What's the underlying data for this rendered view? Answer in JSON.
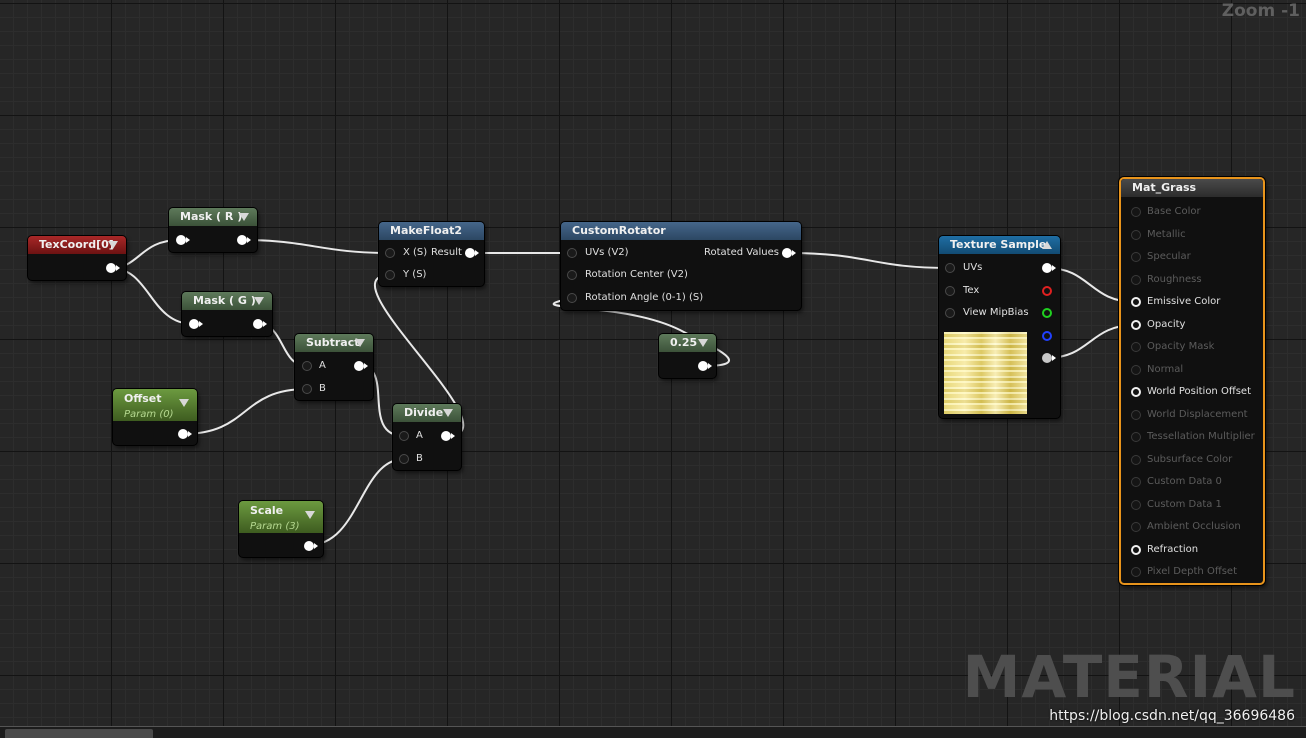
{
  "zoom_label": "Zoom -1",
  "watermark": "MATERIAL",
  "url": "https://blog.csdn.net/qq_36696486",
  "nodes": {
    "texcoord": {
      "title": "TexCoord[0]"
    },
    "mask_r": {
      "title": "Mask ( R )"
    },
    "mask_g": {
      "title": "Mask ( G )"
    },
    "makefloat2": {
      "title": "MakeFloat2",
      "in_x": "X (S)",
      "out": "Result",
      "in_y": "Y (S)"
    },
    "subtract": {
      "title": "Subtract",
      "in_a": "A",
      "in_b": "B"
    },
    "divide": {
      "title": "Divide",
      "in_a": "A",
      "in_b": "B"
    },
    "offset": {
      "title": "Offset",
      "subtitle": "Param (0)"
    },
    "scale": {
      "title": "Scale",
      "subtitle": "Param (3)"
    },
    "customrotator": {
      "title": "CustomRotator",
      "in_uvs": "UVs (V2)",
      "in_center": "Rotation Center (V2)",
      "in_angle": "Rotation Angle (0-1) (S)",
      "out": "Rotated Values"
    },
    "constant": {
      "title": "0.25"
    },
    "texsample": {
      "title": "Texture Sample",
      "in_uvs": "UVs",
      "in_tex": "Tex",
      "in_mip": "View MipBias"
    },
    "material": {
      "title": "Mat_Grass",
      "inputs": [
        {
          "label": "Base Color",
          "active": false
        },
        {
          "label": "Metallic",
          "active": false
        },
        {
          "label": "Specular",
          "active": false
        },
        {
          "label": "Roughness",
          "active": false
        },
        {
          "label": "Emissive Color",
          "active": true
        },
        {
          "label": "Opacity",
          "active": true
        },
        {
          "label": "Opacity Mask",
          "active": false
        },
        {
          "label": "Normal",
          "active": false
        },
        {
          "label": "World Position Offset",
          "active": true
        },
        {
          "label": "World Displacement",
          "active": false
        },
        {
          "label": "Tessellation Multiplier",
          "active": false
        },
        {
          "label": "Subsurface Color",
          "active": false
        },
        {
          "label": "Custom Data 0",
          "active": false
        },
        {
          "label": "Custom Data 1",
          "active": false
        },
        {
          "label": "Ambient Occlusion",
          "active": false
        },
        {
          "label": "Refraction",
          "active": true
        },
        {
          "label": "Pixel Depth Offset",
          "active": false
        }
      ]
    }
  },
  "colors": {
    "wire": "#e8e8e8",
    "material_border": "#e8941c",
    "tex_header": "#1f6ea4",
    "texcoord_header": "#a92828",
    "param_header": "#6c9a40"
  }
}
